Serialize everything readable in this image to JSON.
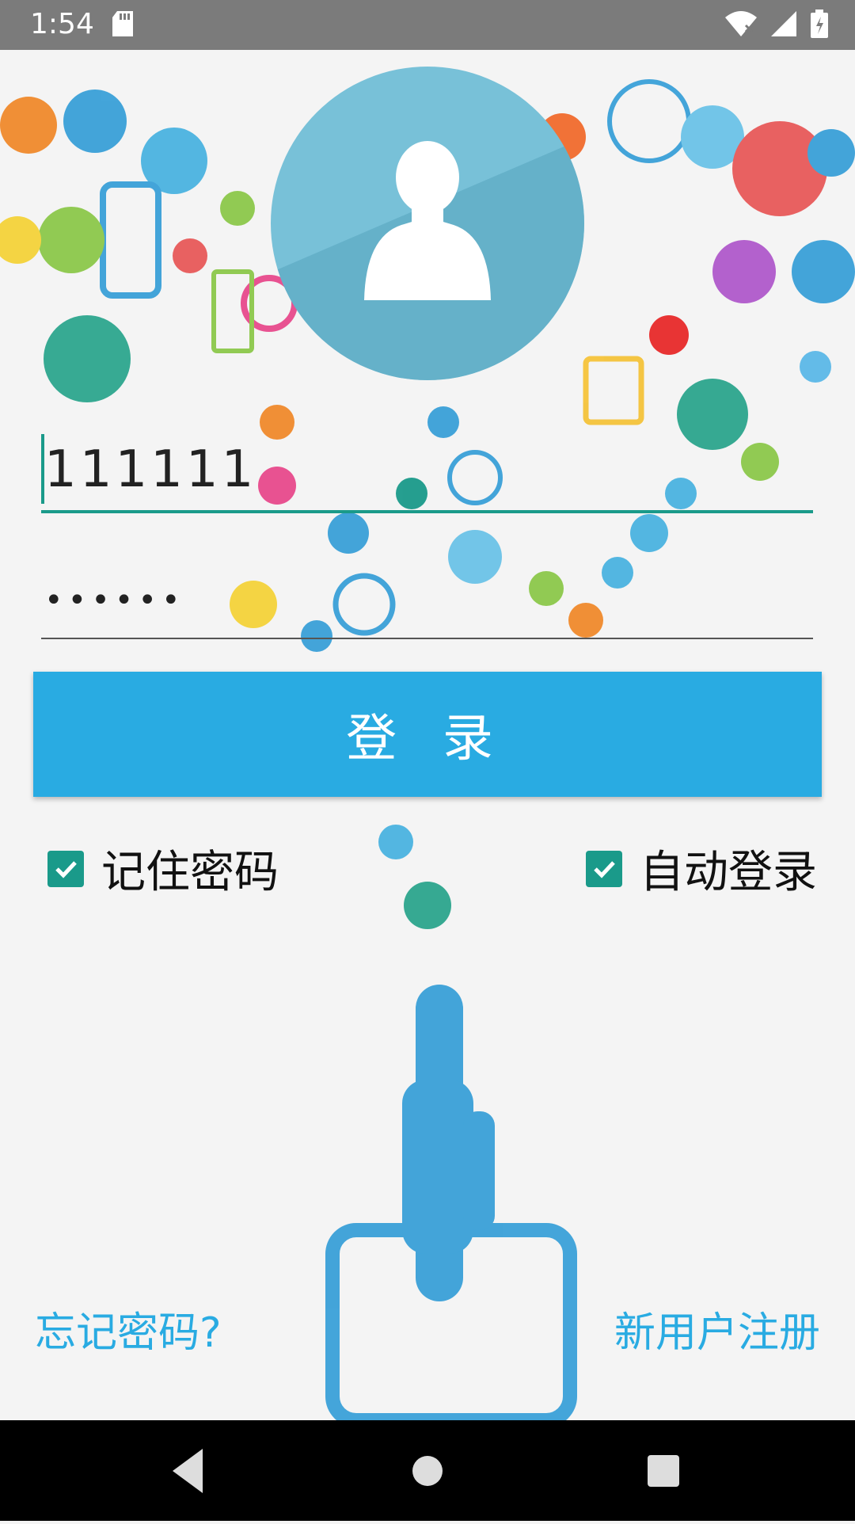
{
  "status_bar": {
    "time": "1:54"
  },
  "login_form": {
    "username_value": "111111",
    "password_masked": "••••••",
    "login_button_label": "登 录"
  },
  "options": {
    "remember_password_label": "记住密码",
    "remember_password_checked": true,
    "auto_login_label": "自动登录",
    "auto_login_checked": true
  },
  "links": {
    "forgot_password": "忘记密码?",
    "register": "新用户注册"
  },
  "colors": {
    "accent": "#29abe2",
    "checkbox": "#1a9a8a",
    "status_bar": "#7b7b7b"
  },
  "icons": [
    "sd-card-icon",
    "wifi-icon",
    "signal-icon",
    "battery-icon",
    "back-icon",
    "home-icon",
    "recents-icon",
    "avatar-icon"
  ]
}
